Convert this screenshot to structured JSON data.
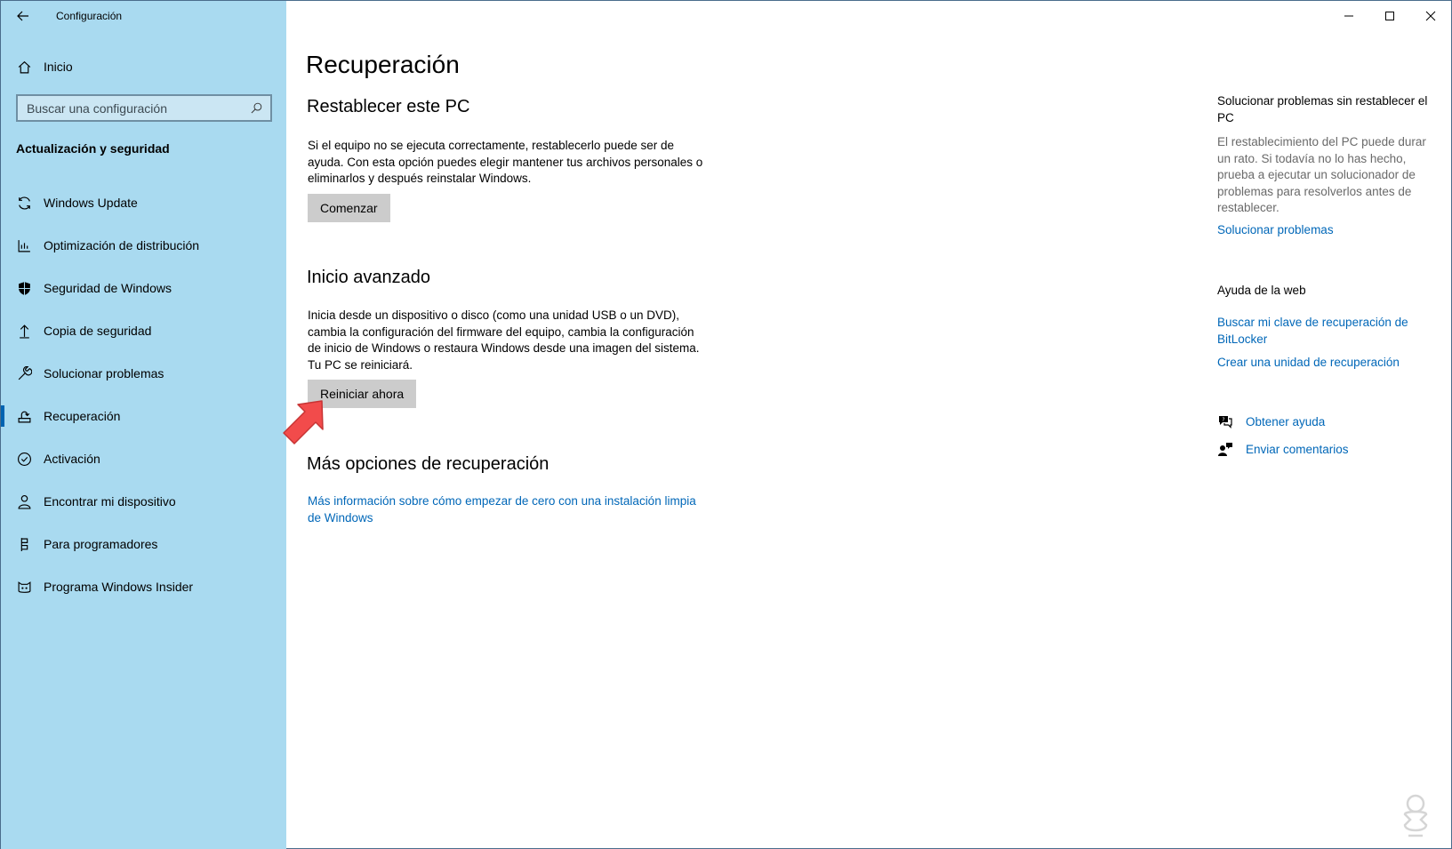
{
  "window": {
    "title": "Configuración"
  },
  "sidebar": {
    "home_label": "Inicio",
    "search_placeholder": "Buscar una configuración",
    "section_title": "Actualización y seguridad",
    "items": [
      {
        "label": "Windows Update",
        "icon": "sync-icon"
      },
      {
        "label": "Optimización de distribución",
        "icon": "delivery-optimization-icon"
      },
      {
        "label": "Seguridad de Windows",
        "icon": "shield-icon"
      },
      {
        "label": "Copia de seguridad",
        "icon": "backup-arrow-icon"
      },
      {
        "label": "Solucionar problemas",
        "icon": "wrench-icon"
      },
      {
        "label": "Recuperación",
        "icon": "recovery-icon",
        "active": true
      },
      {
        "label": "Activación",
        "icon": "check-circle-icon"
      },
      {
        "label": "Encontrar mi dispositivo",
        "icon": "person-locate-icon"
      },
      {
        "label": "Para programadores",
        "icon": "developer-icon"
      },
      {
        "label": "Programa Windows Insider",
        "icon": "insider-cat-icon"
      }
    ]
  },
  "main": {
    "title": "Recuperación",
    "reset": {
      "heading": "Restablecer este PC",
      "description": "Si el equipo no se ejecuta correctamente, restablecerlo puede ser de ayuda. Con esta opción puedes elegir mantener tus archivos personales o eliminarlos y después reinstalar Windows.",
      "button": "Comenzar"
    },
    "advanced": {
      "heading": "Inicio avanzado",
      "description": "Inicia desde un dispositivo o disco (como una unidad USB o un DVD), cambia la configuración del firmware del equipo, cambia la configuración de inicio de Windows o restaura Windows desde una imagen del sistema. Tu PC se reiniciará.",
      "button": "Reiniciar ahora"
    },
    "more": {
      "heading": "Más opciones de recuperación",
      "link": "Más información sobre cómo empezar de cero con una instalación limpia de Windows"
    }
  },
  "right_panel": {
    "troubleshoot_heading": "Solucionar problemas sin restablecer el PC",
    "troubleshoot_text": "El restablecimiento del PC puede durar un rato. Si todavía no lo has hecho, prueba a ejecutar un solucionador de problemas para resolverlos antes de restablecer.",
    "troubleshoot_link": "Solucionar problemas",
    "web_help_heading": "Ayuda de la web",
    "web_links": [
      "Buscar mi clave de recuperación de BitLocker",
      "Crear una unidad de recuperación"
    ],
    "get_help": "Obtener ayuda",
    "feedback": "Enviar comentarios"
  },
  "colors": {
    "sidebar_bg": "#a9daf0",
    "accent": "#0067b8",
    "button_bg": "#cccccc",
    "arrow": "#f24b4b"
  }
}
